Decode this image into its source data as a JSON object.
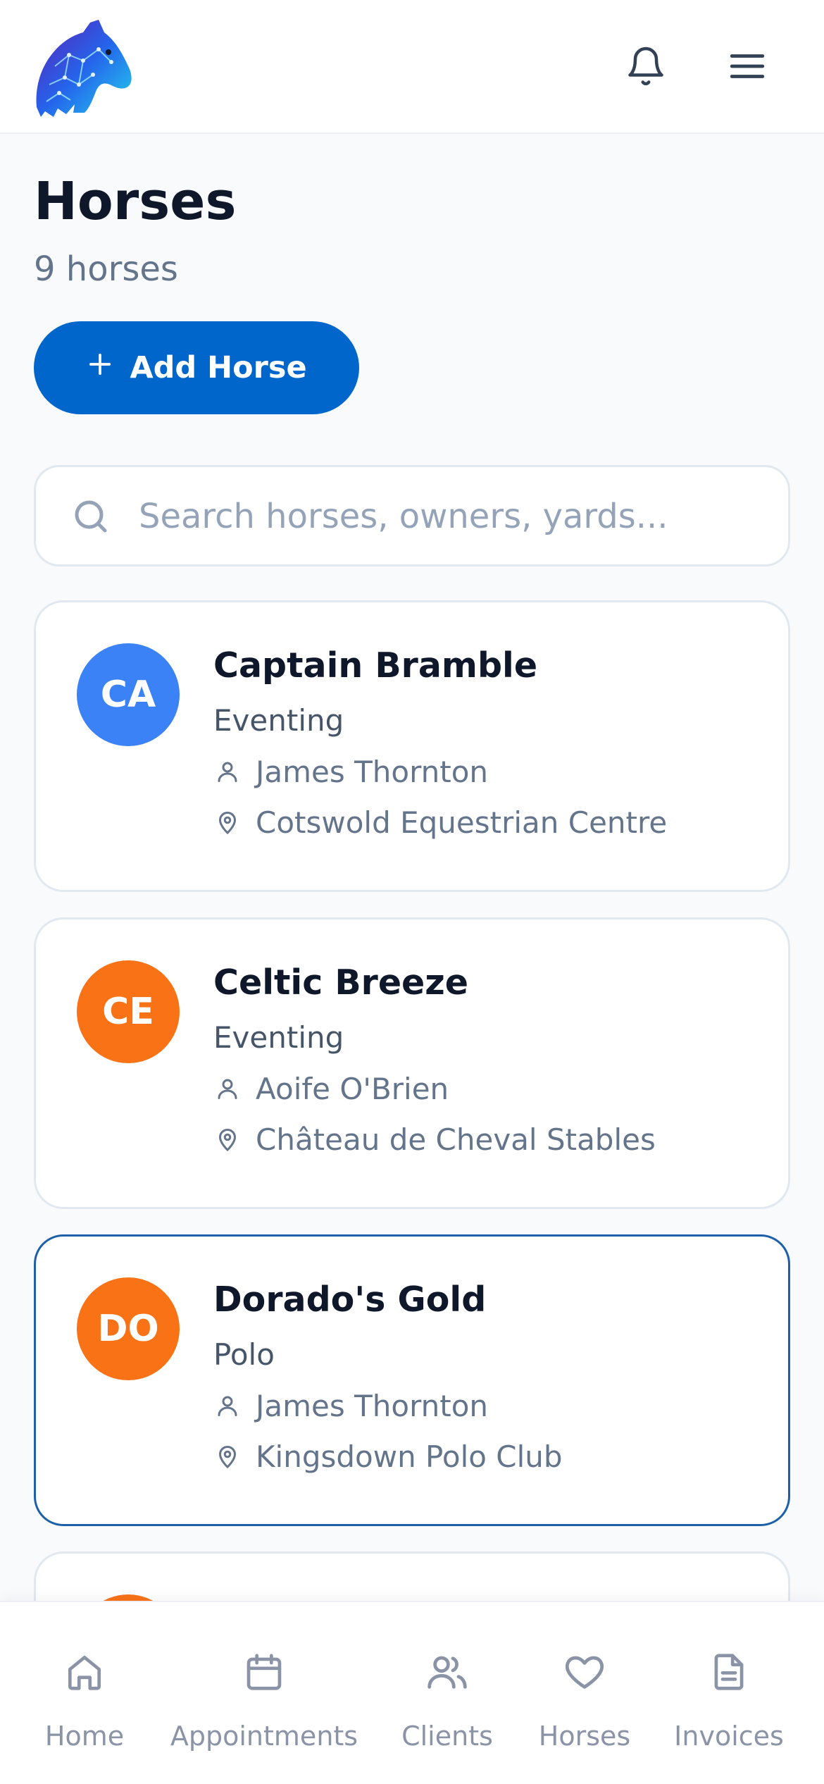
{
  "header": {
    "logo": "horse-head-logo",
    "icons": [
      "bell-icon",
      "hamburger-menu-icon"
    ]
  },
  "page": {
    "title": "Horses",
    "count_label": "9 horses",
    "add_button_label": "Add Horse"
  },
  "search": {
    "placeholder": "Search horses, owners, yards...",
    "value": ""
  },
  "horses": [
    {
      "initials": "CA",
      "name": "Captain Bramble",
      "discipline": "Eventing",
      "owner": "James Thornton",
      "yard": "Cotswold Equestrian Centre",
      "avatar_color": "#3b82f6"
    },
    {
      "initials": "CE",
      "name": "Celtic Breeze",
      "discipline": "Eventing",
      "owner": "Aoife O'Brien",
      "yard": "Château de Cheval Stables",
      "avatar_color": "#f97316"
    },
    {
      "initials": "DO",
      "name": "Dorado's Gold",
      "discipline": "Polo",
      "owner": "James Thornton",
      "yard": "Kingsdown Polo Club",
      "avatar_color": "#f97316",
      "selected": true
    },
    {
      "initials": "",
      "name": "",
      "discipline": "",
      "owner": "",
      "yard": "",
      "avatar_color": "#f97316"
    }
  ],
  "nav": {
    "items": [
      {
        "label": "Home",
        "icon": "home-icon"
      },
      {
        "label": "Appointments",
        "icon": "calendar-icon"
      },
      {
        "label": "Clients",
        "icon": "users-icon"
      },
      {
        "label": "Horses",
        "icon": "heart-icon"
      },
      {
        "label": "Invoices",
        "icon": "document-icon"
      }
    ]
  },
  "colors": {
    "primary": "#0066cc",
    "selected_border": "#1d5fa8",
    "text_dark": "#0f172a",
    "text_muted": "#64748b",
    "nav_inactive": "#8a94a6"
  }
}
